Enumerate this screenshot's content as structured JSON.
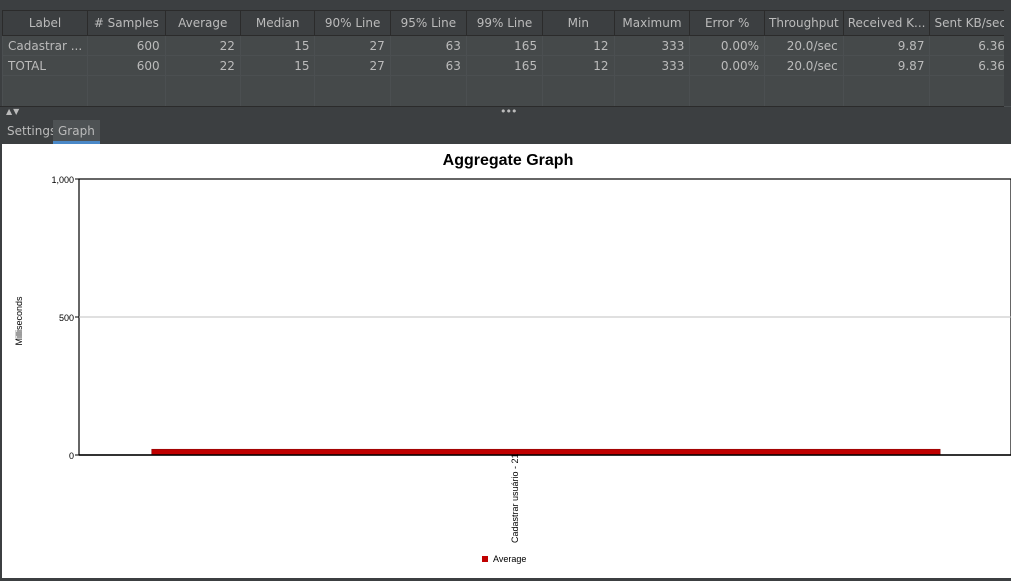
{
  "table": {
    "headers": [
      "Label",
      "# Samples",
      "Average",
      "Median",
      "90% Line",
      "95% Line",
      "99% Line",
      "Min",
      "Maximum",
      "Error %",
      "Throughput",
      "Received K...",
      "Sent KB/sec"
    ],
    "rows": [
      [
        "Cadastrar ...",
        "600",
        "22",
        "15",
        "27",
        "63",
        "165",
        "12",
        "333",
        "0.00%",
        "20.0/sec",
        "9.87",
        "6.36"
      ],
      [
        "TOTAL",
        "600",
        "22",
        "15",
        "27",
        "63",
        "165",
        "12",
        "333",
        "0.00%",
        "20.0/sec",
        "9.87",
        "6.36"
      ]
    ]
  },
  "splitter": {
    "arrows": "▲▼",
    "dots": "•••"
  },
  "tabs": {
    "settings": "Settings",
    "graph": "Graph"
  },
  "chart_data": {
    "type": "bar",
    "title": "Aggregate Graph",
    "xlabel": "",
    "ylabel": "Milliseconds",
    "ylim": [
      0,
      1000
    ],
    "yticks": [
      "0",
      "500",
      "1,000"
    ],
    "categories": [
      "Cadastrar usuário"
    ],
    "series": [
      {
        "name": "Average",
        "values": [
          21
        ],
        "color": "#c00000"
      }
    ],
    "bar_labels": [
      "Cadastrar usuário - 21"
    ],
    "legend": "bottom",
    "grid": true
  }
}
